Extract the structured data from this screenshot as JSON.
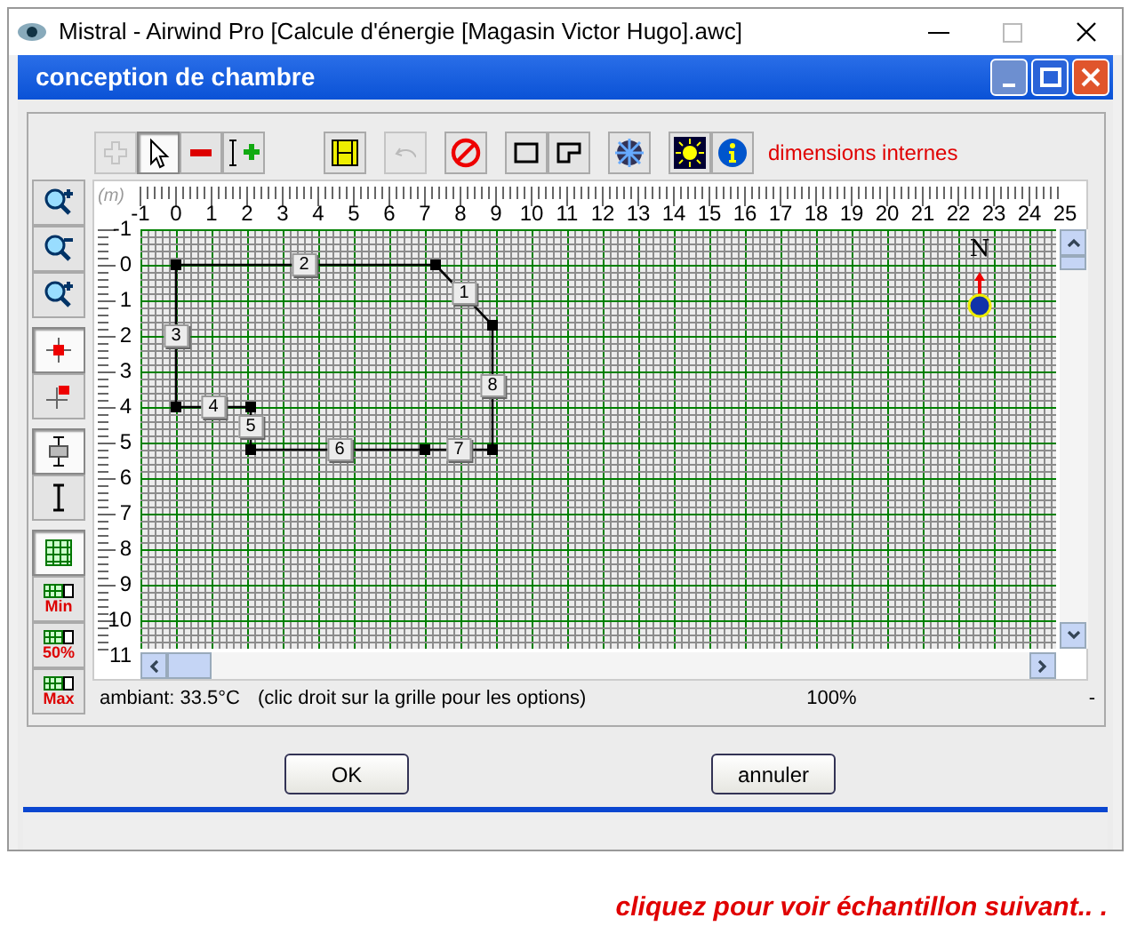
{
  "window": {
    "title": "Mistral - Airwind Pro [Calcule d'énergie [Magasin Victor Hugo].awc]"
  },
  "dialog": {
    "title": "conception de chambre"
  },
  "toolbar": {
    "tools": [
      {
        "kind": "add-point",
        "selected": false,
        "disabled": true
      },
      {
        "kind": "pointer",
        "selected": true,
        "disabled": false
      },
      {
        "kind": "remove",
        "selected": false,
        "disabled": false
      },
      {
        "kind": "insert",
        "selected": false,
        "disabled": false
      },
      {
        "kind": "numbering",
        "selected": false,
        "disabled": false
      },
      {
        "kind": "undo",
        "selected": false,
        "disabled": true
      },
      {
        "kind": "forbidden",
        "selected": false,
        "disabled": false
      },
      {
        "kind": "rectangle",
        "selected": false,
        "disabled": false
      },
      {
        "kind": "l-shape",
        "selected": false,
        "disabled": false
      },
      {
        "kind": "snowflake",
        "selected": false,
        "disabled": false
      },
      {
        "kind": "sun",
        "selected": false,
        "disabled": false
      },
      {
        "kind": "info",
        "selected": false,
        "disabled": false
      }
    ],
    "mode_label": "dimensions internes"
  },
  "side_tools": [
    {
      "kind": "zoom-in",
      "selected": false
    },
    {
      "kind": "zoom-out",
      "selected": false
    },
    {
      "kind": "zoom-select",
      "selected": false
    },
    {
      "kind": "point",
      "selected": true
    },
    {
      "kind": "flag",
      "selected": false
    },
    {
      "kind": "wall",
      "selected": true
    },
    {
      "kind": "dimension",
      "selected": false
    },
    {
      "kind": "grid",
      "selected": true
    },
    {
      "kind": "level",
      "text": "Min",
      "selected": false
    },
    {
      "kind": "level",
      "text": "50%",
      "selected": false
    },
    {
      "kind": "level",
      "text": "Max",
      "selected": false
    }
  ],
  "ruler": {
    "unit": "(m)",
    "x_ticks": [
      "-1",
      "0",
      "1",
      "2",
      "3",
      "4",
      "5",
      "6",
      "7",
      "8",
      "9",
      "10",
      "11",
      "12",
      "13",
      "14",
      "15",
      "16",
      "17",
      "18",
      "19",
      "20",
      "21",
      "22",
      "23",
      "24",
      "25"
    ],
    "y_ticks": [
      "-1",
      "0",
      "1",
      "2",
      "3",
      "4",
      "5",
      "6",
      "7",
      "8",
      "9",
      "10",
      "11"
    ]
  },
  "walls": [
    {
      "label": "1"
    },
    {
      "label": "2"
    },
    {
      "label": "3"
    },
    {
      "label": "4"
    },
    {
      "label": "5"
    },
    {
      "label": "6"
    },
    {
      "label": "7"
    },
    {
      "label": "8"
    }
  ],
  "compass": {
    "label": "N"
  },
  "status_bar": {
    "ambient": "ambiant: 33.5°C",
    "hint": "(clic droit sur la grille pour les options)",
    "zoom": "100%",
    "extra": "-"
  },
  "buttons": [
    {
      "label": "OK"
    },
    {
      "label": "annuler"
    }
  ],
  "footer": "cliquez pour voir échantillon suivant.. ."
}
